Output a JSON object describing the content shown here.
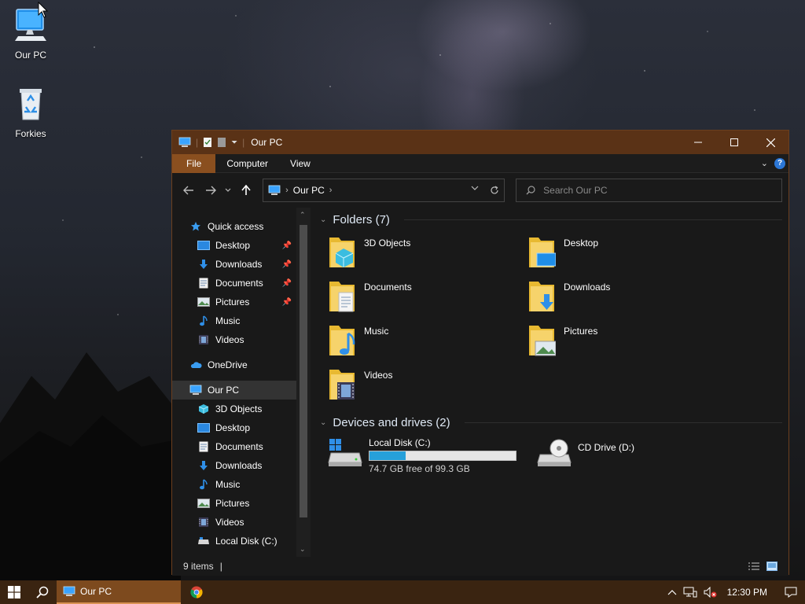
{
  "desktop": {
    "icons": [
      {
        "label": "Our PC"
      },
      {
        "label": "Forkies"
      }
    ]
  },
  "window": {
    "title": "Our PC",
    "ribbon_tabs": [
      "File",
      "Computer",
      "View"
    ],
    "help_label": "?",
    "address": {
      "location": "Our PC"
    },
    "search": {
      "placeholder": "Search Our PC"
    },
    "nav": {
      "quick_access": "Quick access",
      "quick_items": [
        "Desktop",
        "Downloads",
        "Documents",
        "Pictures",
        "Music",
        "Videos"
      ],
      "onedrive": "OneDrive",
      "our_pc": "Our PC",
      "pc_items": [
        "3D Objects",
        "Desktop",
        "Documents",
        "Downloads",
        "Music",
        "Pictures",
        "Videos",
        "Local Disk (C:)"
      ]
    },
    "folders_header": "Folders (7)",
    "folders": [
      "3D Objects",
      "Desktop",
      "Documents",
      "Downloads",
      "Music",
      "Pictures",
      "Videos"
    ],
    "devices_header": "Devices and drives (2)",
    "drives": [
      {
        "name": "Local Disk (C:)",
        "detail": "74.7 GB free of 99.3 GB",
        "used_fraction": 0.248
      },
      {
        "name": "CD Drive (D:)"
      }
    ],
    "status": {
      "items": "9 items"
    }
  },
  "taskbar": {
    "app_label": "Our PC",
    "time": "12:30 PM"
  },
  "colors": {
    "accent": "#8a4f1f",
    "titlebar": "#5a3216",
    "taskbar": "#3a2411",
    "drive_fill": "#26a0da"
  }
}
